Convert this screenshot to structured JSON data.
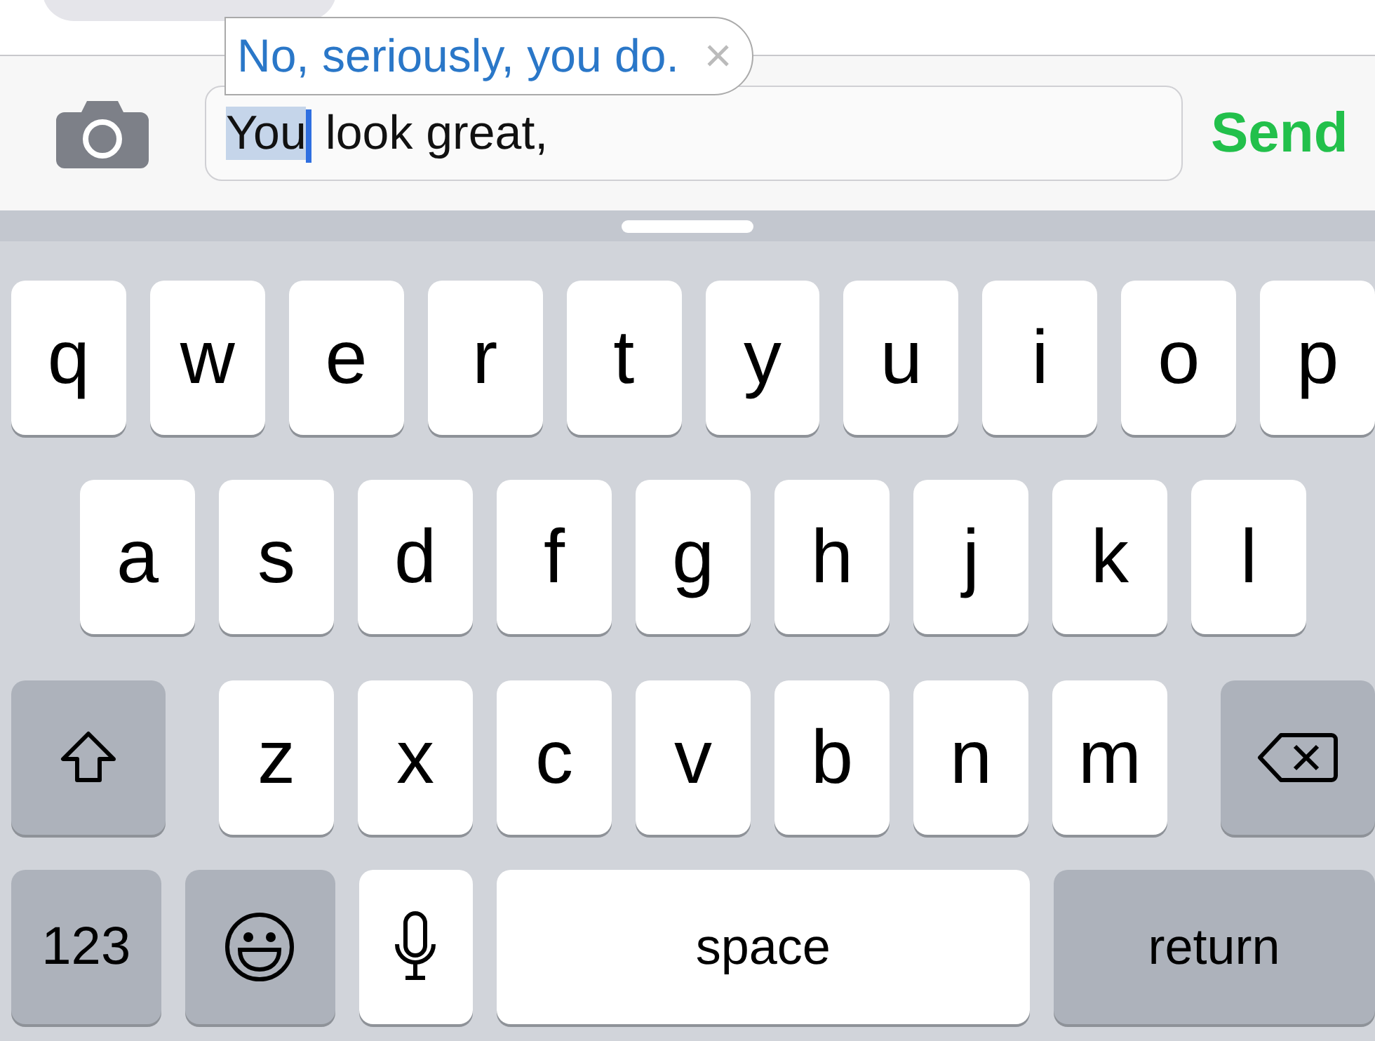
{
  "suggestion": {
    "text": "No, seriously, you do.",
    "dismiss": "×"
  },
  "input": {
    "parts": [
      {
        "text": "You",
        "highlighted": true
      },
      {
        "text": " look great,",
        "highlighted": false
      }
    ]
  },
  "send": "Send",
  "keyboard": {
    "rows": [
      {
        "keys": [
          {
            "kind": "letter",
            "label": "q"
          },
          {
            "kind": "letter",
            "label": "w"
          },
          {
            "kind": "letter",
            "label": "e"
          },
          {
            "kind": "letter",
            "label": "r"
          },
          {
            "kind": "letter",
            "label": "t"
          },
          {
            "kind": "letter",
            "label": "y"
          },
          {
            "kind": "letter",
            "label": "u"
          },
          {
            "kind": "letter",
            "label": "i"
          },
          {
            "kind": "letter",
            "label": "o"
          },
          {
            "kind": "letter",
            "label": "p"
          }
        ]
      },
      {
        "keys": [
          {
            "kind": "letter",
            "label": "a"
          },
          {
            "kind": "letter",
            "label": "s"
          },
          {
            "kind": "letter",
            "label": "d"
          },
          {
            "kind": "letter",
            "label": "f"
          },
          {
            "kind": "letter",
            "label": "g"
          },
          {
            "kind": "letter",
            "label": "h"
          },
          {
            "kind": "letter",
            "label": "j"
          },
          {
            "kind": "letter",
            "label": "k"
          },
          {
            "kind": "letter",
            "label": "l"
          }
        ]
      },
      {
        "keys": [
          {
            "kind": "shift"
          },
          {
            "kind": "letter",
            "label": "z"
          },
          {
            "kind": "letter",
            "label": "x"
          },
          {
            "kind": "letter",
            "label": "c"
          },
          {
            "kind": "letter",
            "label": "v"
          },
          {
            "kind": "letter",
            "label": "b"
          },
          {
            "kind": "letter",
            "label": "n"
          },
          {
            "kind": "letter",
            "label": "m"
          },
          {
            "kind": "delete"
          }
        ]
      },
      {
        "keys": [
          {
            "kind": "number",
            "label": "123"
          },
          {
            "kind": "emoji"
          },
          {
            "kind": "mic"
          },
          {
            "kind": "space",
            "label": "space"
          },
          {
            "kind": "return",
            "label": "return"
          }
        ]
      }
    ]
  }
}
